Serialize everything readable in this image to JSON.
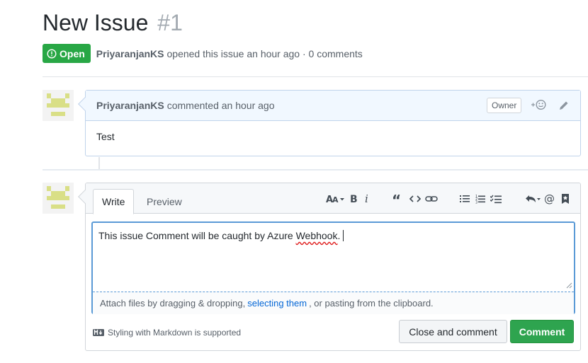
{
  "issue": {
    "title": "New Issue",
    "number": "#1",
    "state": "Open",
    "author": "PriyaranjanKS",
    "meta_text": "opened this issue an hour ago · 0 comments"
  },
  "comment": {
    "author": "PriyaranjanKS",
    "action_text": "commented an hour ago",
    "role_badge": "Owner",
    "body": "Test"
  },
  "editor": {
    "tabs": [
      {
        "label": "Write",
        "active": true
      },
      {
        "label": "Preview",
        "active": false
      }
    ],
    "toolbar": [
      "header-text-icon",
      "bold-icon",
      "italic-icon",
      "quote-icon",
      "code-icon",
      "link-icon",
      "unordered-list-icon",
      "ordered-list-icon",
      "task-list-icon",
      "reply-icon",
      "mention-icon",
      "saved-replies-icon"
    ],
    "text_before": "This issue Comment will be caught by Azure ",
    "text_misspelled": "Webhook",
    "text_after": ".",
    "attach_prefix": "Attach files by dragging & dropping,",
    "attach_link": "selecting them",
    "attach_suffix": ", or pasting from the clipboard.",
    "markdown_note": "Styling with Markdown is supported"
  },
  "buttons": {
    "close_and_comment": "Close and comment",
    "comment": "Comment"
  },
  "colors": {
    "open_green": "#28a745",
    "comment_green": "#2ea44f",
    "link_blue": "#0366d6",
    "focus_blue": "#5a9ad6",
    "avatar_yellow": "#d9df86"
  }
}
